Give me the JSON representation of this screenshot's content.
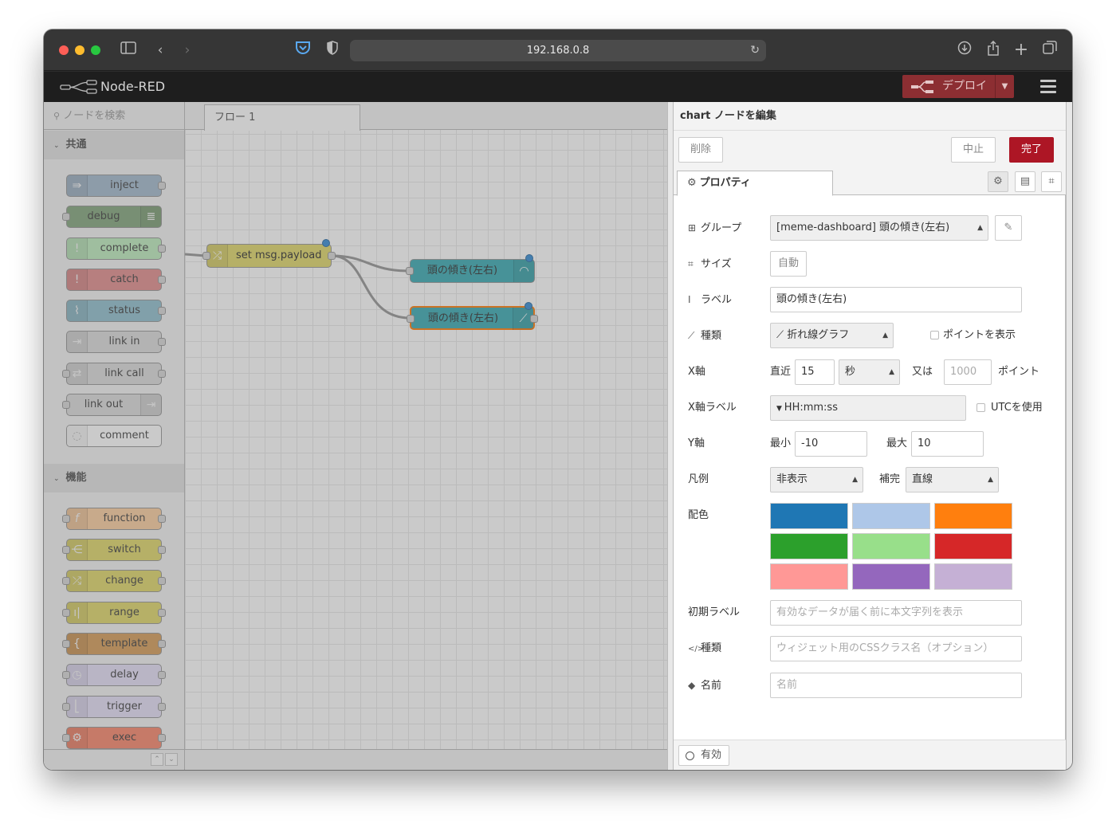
{
  "browser": {
    "url": "192.168.0.8"
  },
  "app": {
    "title": "Node-RED",
    "deploy_label": "デプロイ"
  },
  "palette": {
    "search_placeholder": "ノードを検索",
    "categories": [
      {
        "label": "共通",
        "nodes": [
          "inject",
          "debug",
          "complete",
          "catch",
          "status",
          "link in",
          "link call",
          "link out",
          "comment"
        ]
      },
      {
        "label": "機能",
        "nodes": [
          "function",
          "switch",
          "change",
          "range",
          "template",
          "delay",
          "trigger",
          "exec"
        ]
      }
    ]
  },
  "workspace": {
    "tab_label": "フロー 1",
    "nodes": [
      {
        "label": "set msg.payload"
      },
      {
        "label": "頭の傾き(左右)"
      },
      {
        "label": "頭の傾き(左右)"
      }
    ]
  },
  "tray": {
    "title": "chart ノードを編集",
    "delete_label": "削除",
    "cancel_label": "中止",
    "done_label": "完了",
    "properties_tab": "プロパティ",
    "group_label": "グループ",
    "group_value": "[meme-dashboard] 頭の傾き(左右)",
    "size_label": "サイズ",
    "size_value": "自動",
    "label_label": "ラベル",
    "label_value": "頭の傾き(左右)",
    "type_label": "種類",
    "type_value": "折れ線グラフ",
    "show_points_label": "ポイントを表示",
    "xaxis_label": "X軸",
    "xaxis_recent": "直近",
    "xaxis_value": "15",
    "xaxis_unit": "秒",
    "xaxis_or": "又は",
    "xaxis_points_placeholder": "1000",
    "xaxis_points_label": "ポイント",
    "xlabel_label": "X軸ラベル",
    "xlabel_value": "HH:mm:ss",
    "utc_label": "UTCを使用",
    "yaxis_label": "Y軸",
    "ymin_label": "最小",
    "ymin_value": "-10",
    "ymax_label": "最大",
    "ymax_value": "10",
    "legend_label": "凡例",
    "legend_value": "非表示",
    "interp_label": "補完",
    "interp_value": "直線",
    "colors_label": "配色",
    "colors": [
      "#1f77b4",
      "#aec7e8",
      "#ff7f0e",
      "#2ca02c",
      "#98df8a",
      "#d62728",
      "#ff9896",
      "#9467bd",
      "#c5b0d5"
    ],
    "initial_label": "初期ラベル",
    "initial_placeholder": "有効なデータが届く前に本文字列を表示",
    "class_label": "種類",
    "class_placeholder": "ウィジェット用のCSSクラス名（オプション）",
    "name_label": "名前",
    "name_placeholder": "名前",
    "enabled_label": "有効"
  }
}
